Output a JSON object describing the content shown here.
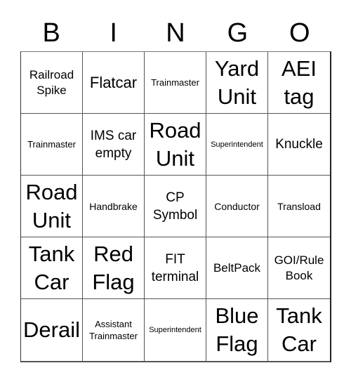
{
  "header": {
    "letters": [
      "B",
      "I",
      "N",
      "G",
      "O"
    ]
  },
  "cells": [
    {
      "text": "Railroad Spike",
      "size": "s-sm"
    },
    {
      "text": "Flatcar",
      "size": "s-l"
    },
    {
      "text": "Trainmaster",
      "size": "s-xs"
    },
    {
      "text": "Yard Unit",
      "size": "s-xl"
    },
    {
      "text": "AEI tag",
      "size": "s-xl"
    },
    {
      "text": "Trainmaster",
      "size": "s-xs"
    },
    {
      "text": "IMS car empty",
      "size": "s-m"
    },
    {
      "text": "Road Unit",
      "size": "s-xl"
    },
    {
      "text": "Superintendent",
      "size": "s-xxs"
    },
    {
      "text": "Knuckle",
      "size": "s-m"
    },
    {
      "text": "Road Unit",
      "size": "s-xl"
    },
    {
      "text": "Handbrake",
      "size": "s-s"
    },
    {
      "text": "CP Symbol",
      "size": "s-m"
    },
    {
      "text": "Conductor",
      "size": "s-s"
    },
    {
      "text": "Transload",
      "size": "s-s"
    },
    {
      "text": "Tank Car",
      "size": "s-xl"
    },
    {
      "text": "Red Flag",
      "size": "s-xl"
    },
    {
      "text": "FIT terminal",
      "size": "s-m"
    },
    {
      "text": "BeltPack",
      "size": "s-sm"
    },
    {
      "text": "GOI/Rule Book",
      "size": "s-sm"
    },
    {
      "text": "Derail",
      "size": "s-xl"
    },
    {
      "text": "Assistant Trainmaster",
      "size": "s-xs"
    },
    {
      "text": "Superintendent",
      "size": "s-xxs"
    },
    {
      "text": "Blue Flag",
      "size": "s-xl"
    },
    {
      "text": "Tank Car",
      "size": "s-xl"
    }
  ]
}
